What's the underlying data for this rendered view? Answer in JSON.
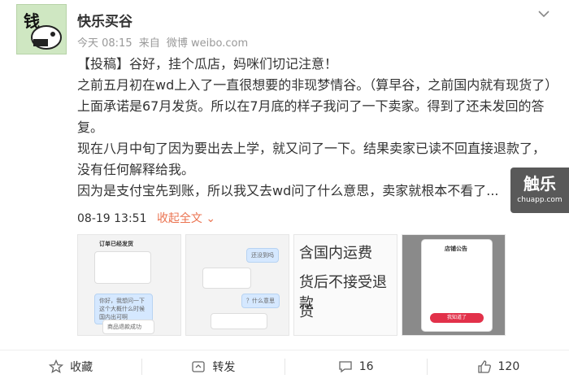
{
  "user": {
    "avatar_text": "钱",
    "name": "快乐买谷"
  },
  "meta": {
    "time": "今天 08:15",
    "source_prefix": "来自",
    "source": "微博 weibo.com"
  },
  "post": {
    "tag": "【投稿】",
    "lines": [
      "谷好，挂个瓜店，妈咪们切记注意！",
      "之前五月初在wd上入了一直很想要的非现梦情谷。（算早谷，之前国内就有现货了）上面承诺是67月发货。所以在7月底的样子我问了一下卖家。得到了还未发回的答复。",
      "现在八月中旬了因为要出去上学，就又问了一下。结果卖家已读不回直接退款了，没有任何解释给我。",
      "因为是支付宝先到账，所以我又去wd问了什么意思，卖家就根本不看了..."
    ],
    "date": "08-19 13:51",
    "collapse_label": "收起全文",
    "collapse_arrow": "⌄"
  },
  "watermark": {
    "title": "触乐",
    "sub": "chuapp.com"
  },
  "thumbs": {
    "t1": {
      "title": "订单已经发货",
      "bubble": "你好，我想问一下这个大概什么时候国内出可啊",
      "footer": "商品退款成功"
    },
    "t2": {
      "b1": "还没到吗",
      "b2": "？什么意思"
    },
    "t3": {
      "l1": "含国内运费",
      "l2": "货后不接受退款",
      "l3": "货"
    },
    "t4": {
      "title": "店铺公告",
      "btn": "我知道了"
    }
  },
  "actions": {
    "favorite": "收藏",
    "repost": "转发",
    "comment_count": "16",
    "like_count": "120"
  }
}
